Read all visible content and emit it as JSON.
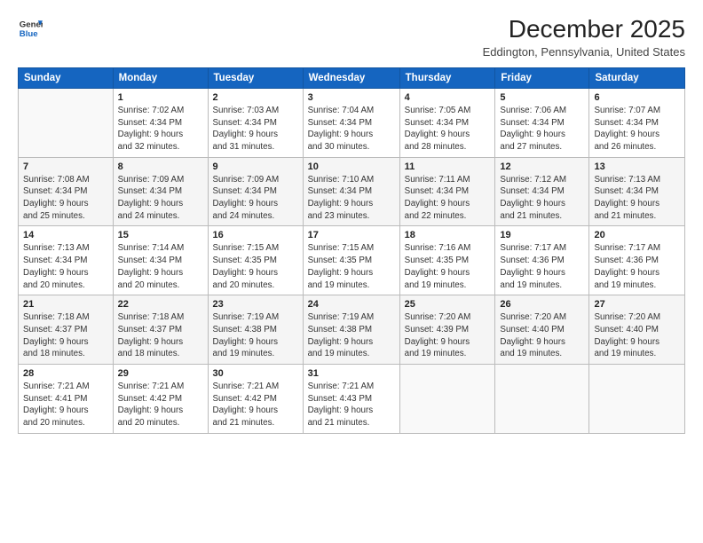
{
  "logo": {
    "line1": "General",
    "line2": "Blue"
  },
  "title": "December 2025",
  "location": "Eddington, Pennsylvania, United States",
  "days_header": [
    "Sunday",
    "Monday",
    "Tuesday",
    "Wednesday",
    "Thursday",
    "Friday",
    "Saturday"
  ],
  "weeks": [
    [
      {
        "num": "",
        "info": ""
      },
      {
        "num": "1",
        "info": "Sunrise: 7:02 AM\nSunset: 4:34 PM\nDaylight: 9 hours\nand 32 minutes."
      },
      {
        "num": "2",
        "info": "Sunrise: 7:03 AM\nSunset: 4:34 PM\nDaylight: 9 hours\nand 31 minutes."
      },
      {
        "num": "3",
        "info": "Sunrise: 7:04 AM\nSunset: 4:34 PM\nDaylight: 9 hours\nand 30 minutes."
      },
      {
        "num": "4",
        "info": "Sunrise: 7:05 AM\nSunset: 4:34 PM\nDaylight: 9 hours\nand 28 minutes."
      },
      {
        "num": "5",
        "info": "Sunrise: 7:06 AM\nSunset: 4:34 PM\nDaylight: 9 hours\nand 27 minutes."
      },
      {
        "num": "6",
        "info": "Sunrise: 7:07 AM\nSunset: 4:34 PM\nDaylight: 9 hours\nand 26 minutes."
      }
    ],
    [
      {
        "num": "7",
        "info": "Sunrise: 7:08 AM\nSunset: 4:34 PM\nDaylight: 9 hours\nand 25 minutes."
      },
      {
        "num": "8",
        "info": "Sunrise: 7:09 AM\nSunset: 4:34 PM\nDaylight: 9 hours\nand 24 minutes."
      },
      {
        "num": "9",
        "info": "Sunrise: 7:09 AM\nSunset: 4:34 PM\nDaylight: 9 hours\nand 24 minutes."
      },
      {
        "num": "10",
        "info": "Sunrise: 7:10 AM\nSunset: 4:34 PM\nDaylight: 9 hours\nand 23 minutes."
      },
      {
        "num": "11",
        "info": "Sunrise: 7:11 AM\nSunset: 4:34 PM\nDaylight: 9 hours\nand 22 minutes."
      },
      {
        "num": "12",
        "info": "Sunrise: 7:12 AM\nSunset: 4:34 PM\nDaylight: 9 hours\nand 21 minutes."
      },
      {
        "num": "13",
        "info": "Sunrise: 7:13 AM\nSunset: 4:34 PM\nDaylight: 9 hours\nand 21 minutes."
      }
    ],
    [
      {
        "num": "14",
        "info": "Sunrise: 7:13 AM\nSunset: 4:34 PM\nDaylight: 9 hours\nand 20 minutes."
      },
      {
        "num": "15",
        "info": "Sunrise: 7:14 AM\nSunset: 4:34 PM\nDaylight: 9 hours\nand 20 minutes."
      },
      {
        "num": "16",
        "info": "Sunrise: 7:15 AM\nSunset: 4:35 PM\nDaylight: 9 hours\nand 20 minutes."
      },
      {
        "num": "17",
        "info": "Sunrise: 7:15 AM\nSunset: 4:35 PM\nDaylight: 9 hours\nand 19 minutes."
      },
      {
        "num": "18",
        "info": "Sunrise: 7:16 AM\nSunset: 4:35 PM\nDaylight: 9 hours\nand 19 minutes."
      },
      {
        "num": "19",
        "info": "Sunrise: 7:17 AM\nSunset: 4:36 PM\nDaylight: 9 hours\nand 19 minutes."
      },
      {
        "num": "20",
        "info": "Sunrise: 7:17 AM\nSunset: 4:36 PM\nDaylight: 9 hours\nand 19 minutes."
      }
    ],
    [
      {
        "num": "21",
        "info": "Sunrise: 7:18 AM\nSunset: 4:37 PM\nDaylight: 9 hours\nand 18 minutes."
      },
      {
        "num": "22",
        "info": "Sunrise: 7:18 AM\nSunset: 4:37 PM\nDaylight: 9 hours\nand 18 minutes."
      },
      {
        "num": "23",
        "info": "Sunrise: 7:19 AM\nSunset: 4:38 PM\nDaylight: 9 hours\nand 19 minutes."
      },
      {
        "num": "24",
        "info": "Sunrise: 7:19 AM\nSunset: 4:38 PM\nDaylight: 9 hours\nand 19 minutes."
      },
      {
        "num": "25",
        "info": "Sunrise: 7:20 AM\nSunset: 4:39 PM\nDaylight: 9 hours\nand 19 minutes."
      },
      {
        "num": "26",
        "info": "Sunrise: 7:20 AM\nSunset: 4:40 PM\nDaylight: 9 hours\nand 19 minutes."
      },
      {
        "num": "27",
        "info": "Sunrise: 7:20 AM\nSunset: 4:40 PM\nDaylight: 9 hours\nand 19 minutes."
      }
    ],
    [
      {
        "num": "28",
        "info": "Sunrise: 7:21 AM\nSunset: 4:41 PM\nDaylight: 9 hours\nand 20 minutes."
      },
      {
        "num": "29",
        "info": "Sunrise: 7:21 AM\nSunset: 4:42 PM\nDaylight: 9 hours\nand 20 minutes."
      },
      {
        "num": "30",
        "info": "Sunrise: 7:21 AM\nSunset: 4:42 PM\nDaylight: 9 hours\nand 21 minutes."
      },
      {
        "num": "31",
        "info": "Sunrise: 7:21 AM\nSunset: 4:43 PM\nDaylight: 9 hours\nand 21 minutes."
      },
      {
        "num": "",
        "info": ""
      },
      {
        "num": "",
        "info": ""
      },
      {
        "num": "",
        "info": ""
      }
    ]
  ]
}
